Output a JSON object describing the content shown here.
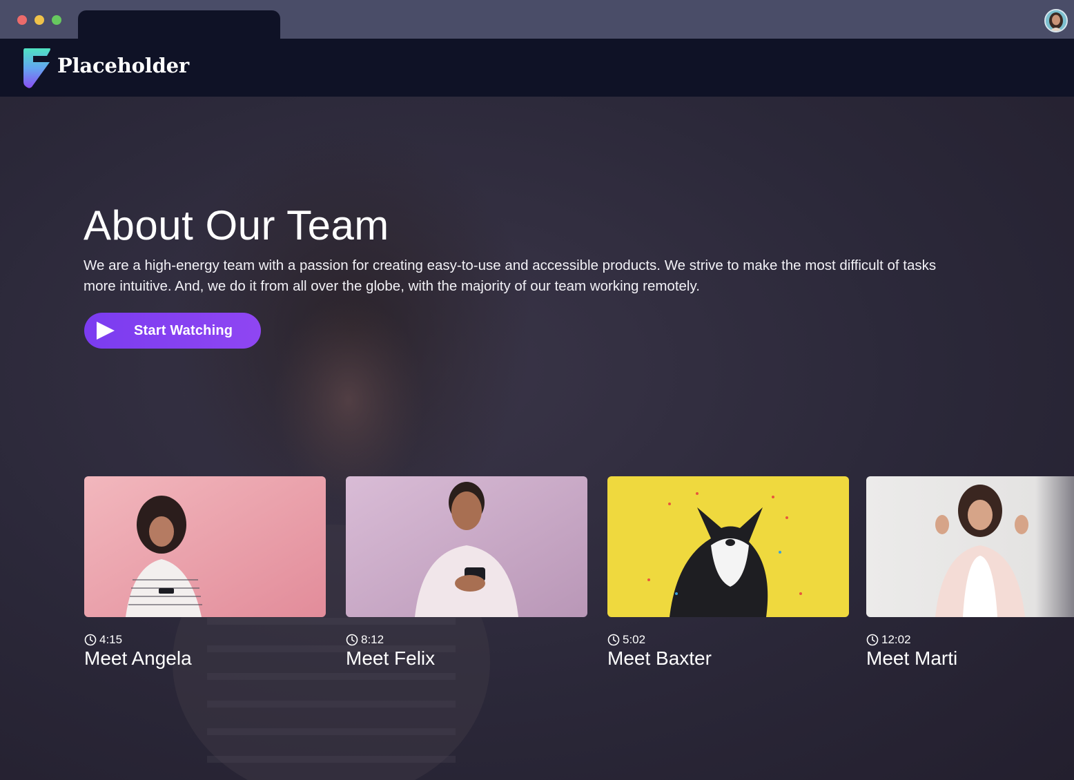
{
  "brand": {
    "name": "Placeholder",
    "accent": "#8b45f0",
    "header_bg": "#0f1226"
  },
  "hero": {
    "title": "About Our Team",
    "description": "We are a high-energy team with a passion for creating easy-to-use and accessible products. We strive to make the most difficult of tasks more intuitive. And, we do it from all over the globe, with the majority of our team working remotely.",
    "cta_label": "Start Watching",
    "cta_icon": "play-icon"
  },
  "videos": [
    {
      "duration": "4:15",
      "title": "Meet Angela",
      "thumb_color": "#e9a7b0"
    },
    {
      "duration": "8:12",
      "title": "Meet Felix",
      "thumb_color": "#c9a9c7"
    },
    {
      "duration": "5:02",
      "title": "Meet Baxter",
      "thumb_color": "#efd93e"
    },
    {
      "duration": "12:02",
      "title": "Meet Marti",
      "thumb_color": "#ecebea"
    }
  ]
}
